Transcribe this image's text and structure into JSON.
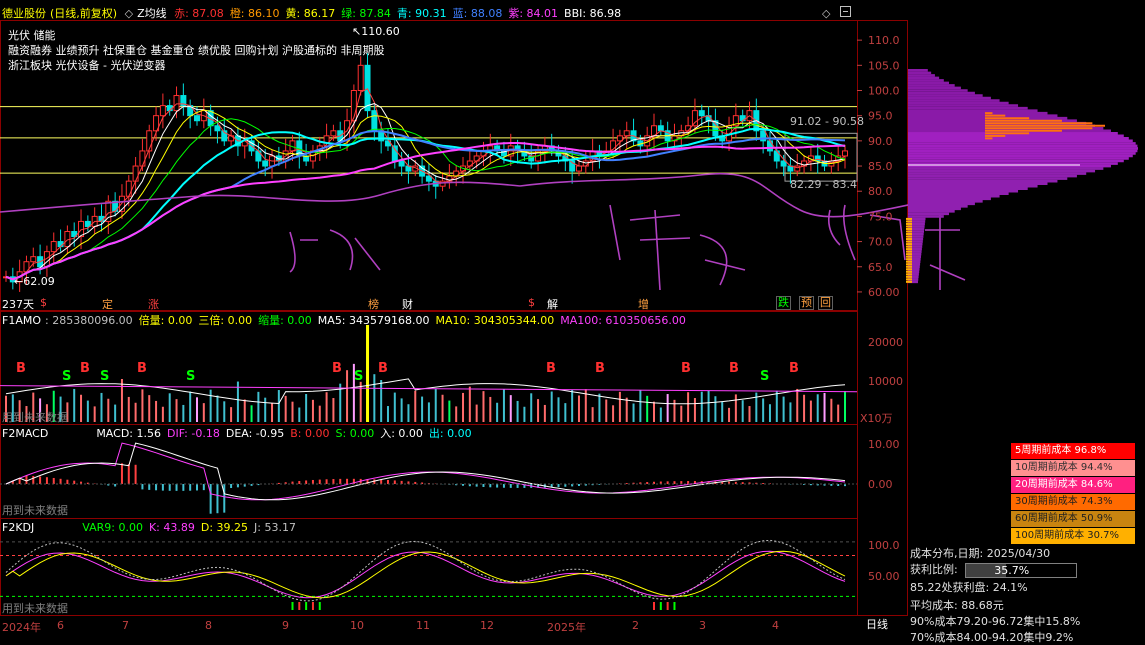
{
  "header": {
    "stock_name": "德业股份",
    "chart_mode": "(日线,前复权)",
    "indicator": "Z均线",
    "diamond_left": "◇",
    "diamond_right": "◇",
    "values": [
      {
        "label": "赤: 87.08",
        "color": "#ff3030"
      },
      {
        "label": "橙: 86.10",
        "color": "#ff9900"
      },
      {
        "label": "黄: 86.17",
        "color": "#ffff00"
      },
      {
        "label": "绿: 87.84",
        "color": "#00ff00"
      },
      {
        "label": "青: 90.31",
        "color": "#00ffff"
      },
      {
        "label": "蓝: 88.08",
        "color": "#4080ff"
      },
      {
        "label": "紫: 84.01",
        "color": "#ff40ff"
      },
      {
        "label": "BBI: 86.98",
        "color": "#ffffff"
      }
    ]
  },
  "info_lines": [
    "光伏 储能",
    "融资融券 业绩预升 社保重仓 基金重仓 绩优股 回购计划 沪股通标的 非周期股",
    "浙江板块 光伏设备 - 光伏逆变器"
  ],
  "main_chart": {
    "high_label": "110.60",
    "low_label": "62.09",
    "range_upper": "91.02 - 90.58",
    "range_lower": "82.29 - 83.4",
    "y_ticks": [
      "110.0",
      "105.0",
      "100.0",
      "95.0",
      "90.0",
      "85.0",
      "80.0",
      "75.0",
      "70.0",
      "65.0",
      "60.00"
    ],
    "event_row": [
      {
        "text": "237天",
        "color": "#ffffff"
      },
      {
        "text": "$",
        "color": "#ff4040"
      },
      {
        "text": "定",
        "color": "#ffa040"
      },
      {
        "text": "涨",
        "color": "#ff4040"
      },
      {
        "text": "榜",
        "color": "#ffa040"
      },
      {
        "text": "财",
        "color": "#ffffff"
      },
      {
        "text": "$",
        "color": "#ff4040"
      },
      {
        "text": "解",
        "color": "#ffffff"
      },
      {
        "text": "增",
        "color": "#ffa040"
      },
      {
        "text": "跌",
        "color": "#00ff00"
      },
      {
        "text": "预",
        "color": "#ffa040"
      },
      {
        "text": "回",
        "color": "#ffa040"
      }
    ],
    "handwriting": [
      "出货",
      "建仓",
      "洗盘"
    ]
  },
  "vol_panel": {
    "name": "F1AMO",
    "items": [
      {
        "label": ": 285380096.00",
        "color": "#c0c0c0"
      },
      {
        "label": "倍量: 0.00",
        "color": "#ffff00"
      },
      {
        "label": "三倍: 0.00",
        "color": "#ffff00"
      },
      {
        "label": "缩量: 0.00",
        "color": "#00ff00"
      },
      {
        "label": "MA5: 343579168.00",
        "color": "#ffffff"
      },
      {
        "label": "MA10: 304305344.00",
        "color": "#ffff00"
      },
      {
        "label": "MA100: 610350656.00",
        "color": "#ff40ff"
      }
    ],
    "y_ticks": [
      "20000",
      "10000"
    ],
    "unit": "X10万",
    "footer": "用到未来数据"
  },
  "macd_panel": {
    "name": "F2MACD",
    "items": [
      {
        "label": "MACD: 1.56",
        "color": "#ffffff"
      },
      {
        "label": "DIF: -0.18",
        "color": "#ff40ff"
      },
      {
        "label": "DEA: -0.95",
        "color": "#ffffff"
      },
      {
        "label": "B: 0.00",
        "color": "#ff3030"
      },
      {
        "label": "S: 0.00",
        "color": "#00ff00"
      },
      {
        "label": "入: 0.00",
        "color": "#ffffff"
      },
      {
        "label": "出: 0.00",
        "color": "#00ffff"
      }
    ],
    "y_ticks": [
      "10.00",
      "0.00"
    ],
    "footer": "用到未来数据"
  },
  "kdj_panel": {
    "name": "F2KDJ",
    "items": [
      {
        "label": "VAR9: 0.00",
        "color": "#00ff00"
      },
      {
        "label": "K: 43.89",
        "color": "#ff40ff"
      },
      {
        "label": "D: 39.25",
        "color": "#ffff00"
      },
      {
        "label": "J: 53.17",
        "color": "#c0c0c0"
      }
    ],
    "y_ticks": [
      "100.0",
      "50.00"
    ],
    "footer": "用到未来数据"
  },
  "time_axis": {
    "labels": [
      "2024年",
      "6",
      "7",
      "8",
      "9",
      "10",
      "11",
      "12",
      "2025年",
      "2",
      "3",
      "4"
    ],
    "period_button": "日线"
  },
  "cost_legend": [
    {
      "label": "5周期前成本 96.8%",
      "bg": "#ff0000",
      "fg": "#ffffff"
    },
    {
      "label": "10周期前成本 94.4%",
      "bg": "#ff9090",
      "fg": "#303030"
    },
    {
      "label": "20周期前成本 84.6%",
      "bg": "#ff2080",
      "fg": "#ffffff"
    },
    {
      "label": "30周期前成本 74.3%",
      "bg": "#ff6a00",
      "fg": "#202020"
    },
    {
      "label": "60周期前成本 50.9%",
      "bg": "#c88410",
      "fg": "#202020"
    },
    {
      "label": "100周期前成本 30.7%",
      "bg": "#ffb000",
      "fg": "#202020"
    }
  ],
  "cost_stats": {
    "title": "成本分布,日期: 2025/04/30",
    "profit_label": "获利比例:",
    "profit_value": "35.7%",
    "profit_at": "85.22处获利盘: 24.1%",
    "avg_cost": "平均成本: 88.68元",
    "cost90": "90%成本79.20-96.72集中15.8%",
    "cost70": "70%成本84.00-94.20集中9.2%"
  },
  "chart_data": {
    "type": "candlestick",
    "title": "德业股份 (日线,前复权)",
    "y_range": [
      58,
      114
    ],
    "annotated_high": 110.6,
    "annotated_low": 62.09,
    "close_series": [
      63,
      62,
      64,
      66,
      67,
      65,
      68,
      70,
      69,
      72,
      71,
      74,
      73,
      75,
      74,
      78,
      76,
      79,
      82,
      85,
      88,
      92,
      95,
      97,
      96,
      99,
      97,
      95,
      94,
      96,
      93,
      92,
      90,
      91,
      89,
      90,
      88,
      86,
      85,
      87,
      86,
      88,
      90,
      87,
      86,
      88,
      89,
      91,
      92,
      90,
      94,
      100,
      105,
      96,
      92,
      90,
      89,
      86,
      85,
      84,
      85,
      83,
      82,
      81,
      82,
      83,
      84,
      85,
      86,
      87,
      88,
      89,
      88,
      87,
      89,
      88,
      87,
      86,
      88,
      89,
      88,
      87,
      86,
      84,
      85,
      86,
      88,
      87,
      88,
      90,
      91,
      92,
      90,
      89,
      91,
      93,
      92,
      90,
      91,
      92,
      93,
      96,
      95,
      94,
      91,
      90,
      93,
      95,
      94,
      96,
      92,
      90,
      88,
      86,
      85,
      84,
      85,
      86,
      87,
      86,
      85,
      86,
      87,
      88
    ]
  }
}
